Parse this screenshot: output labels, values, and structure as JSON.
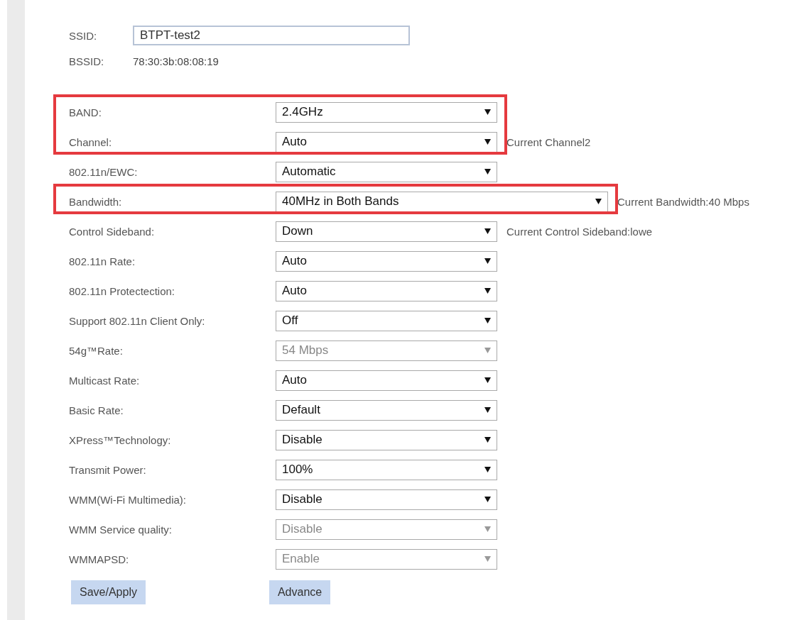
{
  "ssid": {
    "label": "SSID:",
    "value": "BTPT-test2"
  },
  "bssid": {
    "label": "BSSID:",
    "value": "78:30:3b:08:08:19"
  },
  "settings": [
    {
      "label": "BAND:",
      "value": "2.4GHz",
      "disabled": false,
      "wide": false,
      "highlighted": true
    },
    {
      "label": "Channel:",
      "value": "Auto",
      "disabled": false,
      "wide": false,
      "highlighted": true,
      "note": "Current Channel2"
    },
    {
      "label": "802.11n/EWC:",
      "value": "Automatic",
      "disabled": false,
      "wide": false,
      "highlighted": false
    },
    {
      "label": "Bandwidth:",
      "value": "40MHz in Both Bands",
      "disabled": false,
      "wide": true,
      "highlighted": true,
      "note": "Current Bandwidth:40 Mbps"
    },
    {
      "label": "Control Sideband:",
      "value": "Down",
      "disabled": false,
      "wide": false,
      "highlighted": false,
      "note": "Current Control Sideband:lowe"
    },
    {
      "label": "802.11n Rate:",
      "value": "Auto",
      "disabled": false,
      "wide": false,
      "highlighted": false
    },
    {
      "label": "802.11n Protectection:",
      "value": "Auto",
      "disabled": false,
      "wide": false,
      "highlighted": false
    },
    {
      "label": "Support 802.11n Client Only:",
      "value": "Off",
      "disabled": false,
      "wide": false,
      "highlighted": false
    },
    {
      "label": "54g™Rate:",
      "value": "54 Mbps",
      "disabled": true,
      "wide": false,
      "highlighted": false
    },
    {
      "label": "Multicast Rate:",
      "value": "Auto",
      "disabled": false,
      "wide": false,
      "highlighted": false
    },
    {
      "label": "Basic Rate:",
      "value": "Default",
      "disabled": false,
      "wide": false,
      "highlighted": false
    },
    {
      "label": "XPress™Technology:",
      "value": "Disable",
      "disabled": false,
      "wide": false,
      "highlighted": false
    },
    {
      "label": "Transmit Power:",
      "value": "100%",
      "disabled": false,
      "wide": false,
      "highlighted": false
    },
    {
      "label": "WMM(Wi-Fi Multimedia):",
      "value": "Disable",
      "disabled": false,
      "wide": false,
      "highlighted": false
    },
    {
      "label": "WMM Service quality:",
      "value": "Disable",
      "disabled": true,
      "wide": false,
      "highlighted": false
    },
    {
      "label": "WMMAPSD:",
      "value": "Enable",
      "disabled": true,
      "wide": false,
      "highlighted": false
    }
  ],
  "buttons": [
    "Save/Apply",
    "Advance"
  ]
}
